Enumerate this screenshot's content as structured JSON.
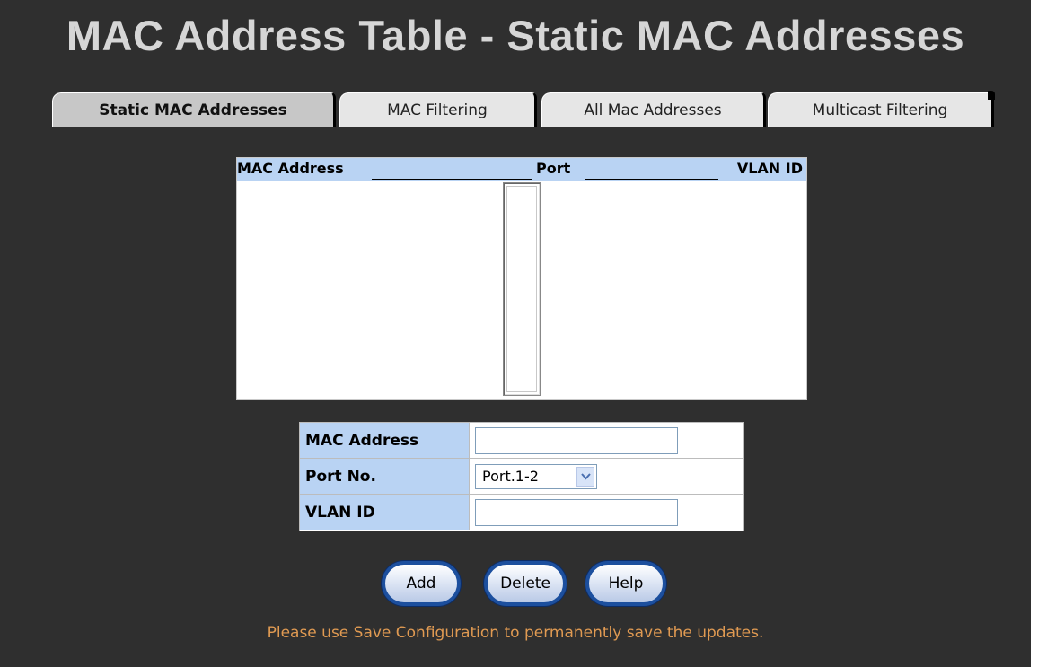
{
  "page": {
    "title": "MAC Address Table - Static MAC Addresses"
  },
  "tabs": [
    {
      "label": "Static MAC Addresses",
      "active": true
    },
    {
      "label": "MAC Filtering",
      "active": false
    },
    {
      "label": "All Mac Addresses",
      "active": false
    },
    {
      "label": "Multicast Filtering",
      "active": false
    }
  ],
  "address_list": {
    "headers": {
      "mac": "MAC Address",
      "port": "Port",
      "vlan": "VLAN ID"
    },
    "entries": []
  },
  "form": {
    "mac_label": "MAC Address",
    "mac_value": "",
    "port_label": "Port No.",
    "port_value": "Port.1-2",
    "vlan_label": "VLAN ID",
    "vlan_value": ""
  },
  "buttons": {
    "add": "Add",
    "delete": "Delete",
    "help": "Help"
  },
  "note": "Please use Save Configuration to permanently save the updates.",
  "colors": {
    "background": "#2f2f2f",
    "title": "#d6d6d6",
    "header_fill": "#b9d3f3",
    "note": "#e09a52",
    "button_border": "#1c4f9e"
  },
  "icons": {
    "select_arrow": "chevron-down-icon"
  }
}
